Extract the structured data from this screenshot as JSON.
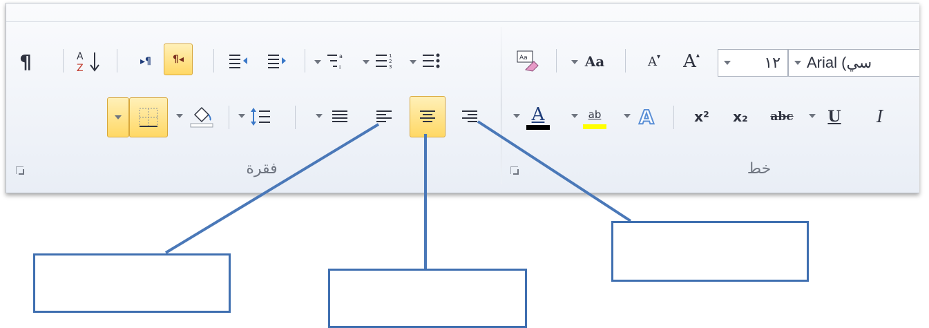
{
  "font_group": {
    "label": "خط",
    "font_name": "Arial (سي",
    "font_size": "١٢",
    "change_case_label": "Aa",
    "grow_font_glyph": "A",
    "shrink_font_glyph": "A",
    "superscript_label": "x²",
    "subscript_label": "x₂",
    "strikethrough_label": "abc",
    "underline_label": "U",
    "italic_label": "I",
    "font_color_glyph": "A",
    "highlight_glyph": "ab",
    "text_effects_glyph": "A"
  },
  "paragraph_group": {
    "label": "فقرة",
    "pilcrow_label": "¶",
    "sort_label": "A Z",
    "ltr_label": "▸¶",
    "rtl_label": "¶◂",
    "active_alignment": "center"
  },
  "colors": {
    "accent_active_fill": "#ffd865",
    "accent_active_border": "#d8a73b",
    "callout_line": "#4a78b8",
    "font_color_bar": "#000000",
    "highlight_bar": "#ffff00"
  },
  "callouts": [
    {
      "label": ""
    },
    {
      "label": ""
    },
    {
      "label": ""
    }
  ]
}
